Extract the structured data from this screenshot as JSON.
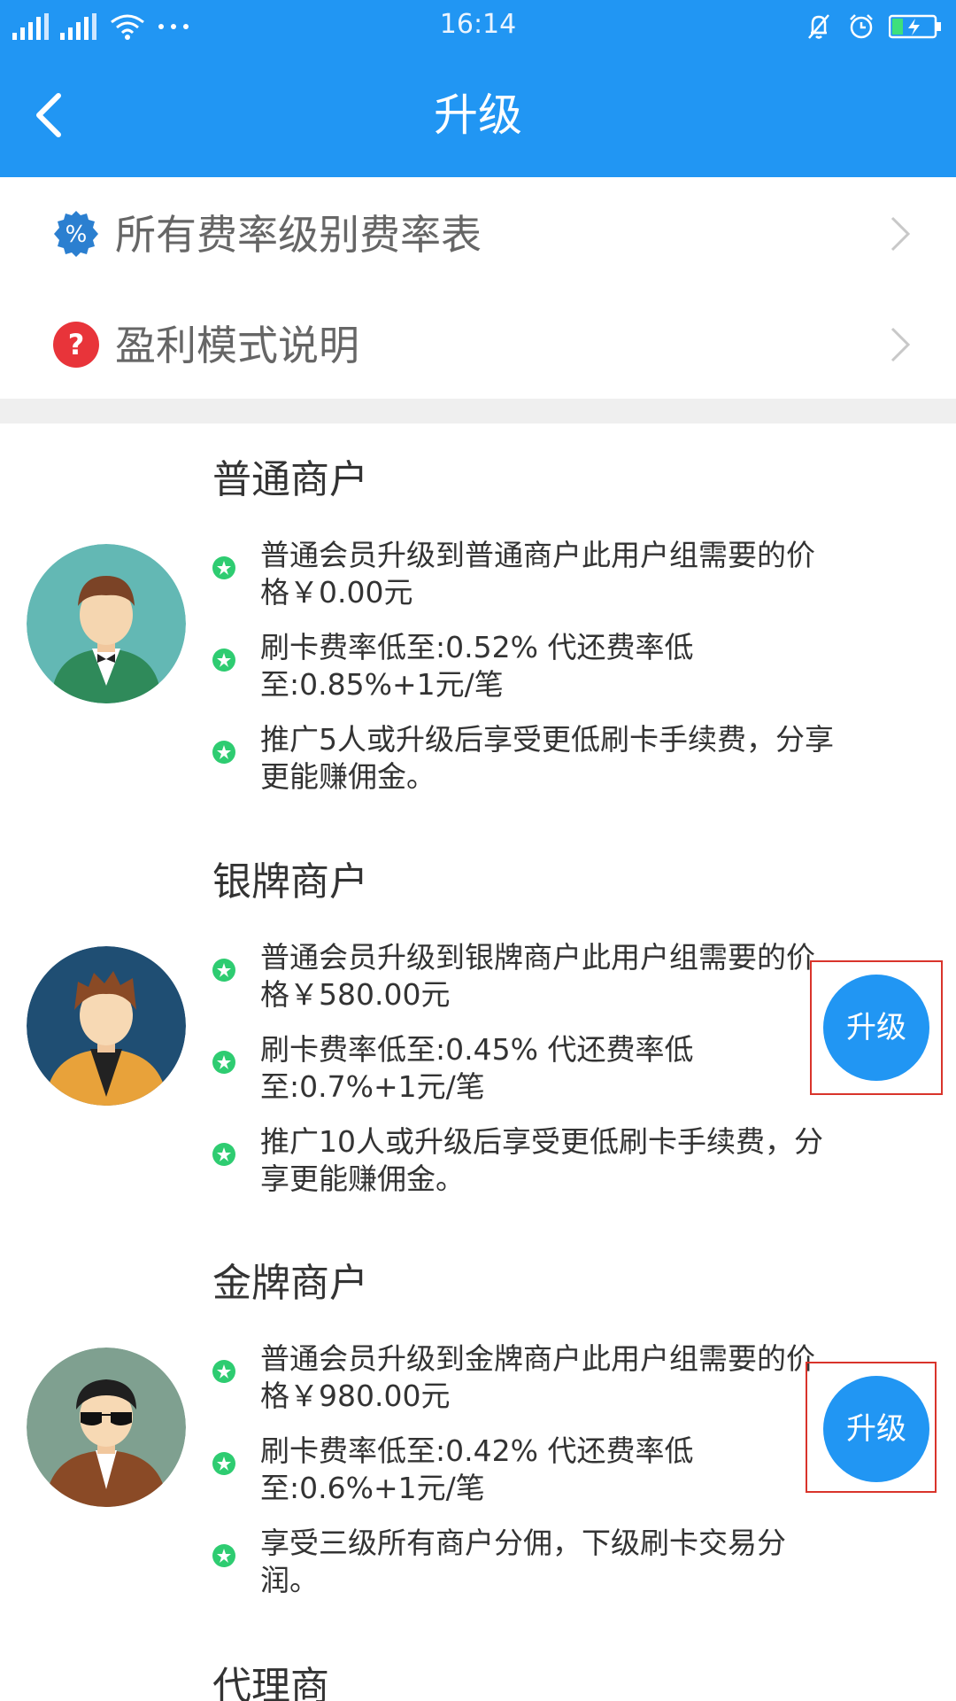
{
  "status_bar": {
    "time": "16:14",
    "icons": [
      "signal-icon",
      "signal-icon",
      "wifi-icon",
      "more-icon",
      "mute-icon",
      "alarm-icon",
      "battery-charging-icon"
    ]
  },
  "nav": {
    "title": "升级",
    "back_icon": "back-chevron-icon"
  },
  "menu": [
    {
      "label": "所有费率级别费率表",
      "icon": "percent-icon"
    },
    {
      "label": "盈利模式说明",
      "icon": "question-icon"
    }
  ],
  "tiers": [
    {
      "title": "普通商户",
      "bullets": [
        "普通会员升级到普通商户此用户组需要的价格￥0.00元",
        "刷卡费率低至:0.52% 代还费率低至:0.85%+1元/笔",
        "推广5人或升级后享受更低刷卡手续费，分享更能赚佣金。"
      ],
      "button": ""
    },
    {
      "title": "银牌商户",
      "bullets": [
        "普通会员升级到银牌商户此用户组需要的价格￥580.00元",
        "刷卡费率低至:0.45% 代还费率低至:0.7%+1元/笔",
        "推广10人或升级后享受更低刷卡手续费，分享更能赚佣金。"
      ],
      "button": "升级"
    },
    {
      "title": "金牌商户",
      "bullets": [
        "普通会员升级到金牌商户此用户组需要的价格￥980.00元",
        "刷卡费率低至:0.42% 代还费率低至:0.6%+1元/笔",
        "享受三级所有商户分佣，下级刷卡交易分润。"
      ],
      "button": "升级"
    }
  ],
  "bottom_tier_title": "代理商",
  "colors": {
    "primary": "#2196f3",
    "bullet": "#2ecc71",
    "highlight": "#d9342b"
  }
}
